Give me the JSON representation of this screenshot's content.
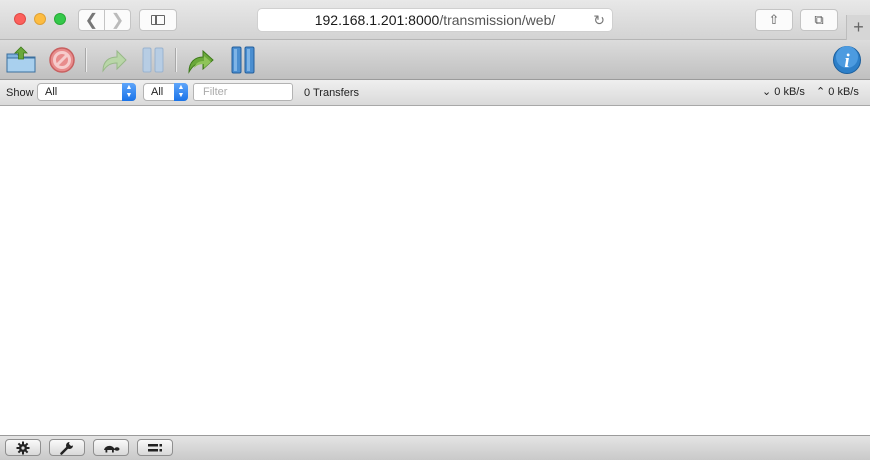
{
  "browser": {
    "url_host": "192.168.1.201:8000",
    "url_path": "/transmission/web/",
    "back_glyph": "❮",
    "forward_glyph": "❯",
    "reload_glyph": "↻",
    "share_glyph": "⇧",
    "tabs_glyph": "⧉",
    "newtab_glyph": "+"
  },
  "toolbar": {
    "icons": [
      "open-torrent-icon",
      "remove-torrent-icon",
      "resume-selected-icon",
      "pause-selected-icon",
      "resume-all-icon",
      "pause-all-icon",
      "inspector-icon"
    ],
    "inspector_glyph": "i"
  },
  "filterbar": {
    "show_label": "Show",
    "status_filter": "All",
    "tracker_filter": "All",
    "filter_placeholder": "Filter",
    "filter_value": "",
    "transfers": "0 Transfers",
    "download_rate": "0 kB/s",
    "upload_rate": "0 kB/s",
    "download_glyph": "⌄",
    "upload_glyph": "⌃"
  },
  "bottombar": {
    "icons": [
      "settings-gear-icon",
      "preferences-wrench-icon",
      "turtle-speed-limit-icon",
      "compact-view-icon"
    ]
  },
  "colors": {
    "accent_blue": "#1a73e8",
    "green_arrow": "#6aa83a"
  }
}
